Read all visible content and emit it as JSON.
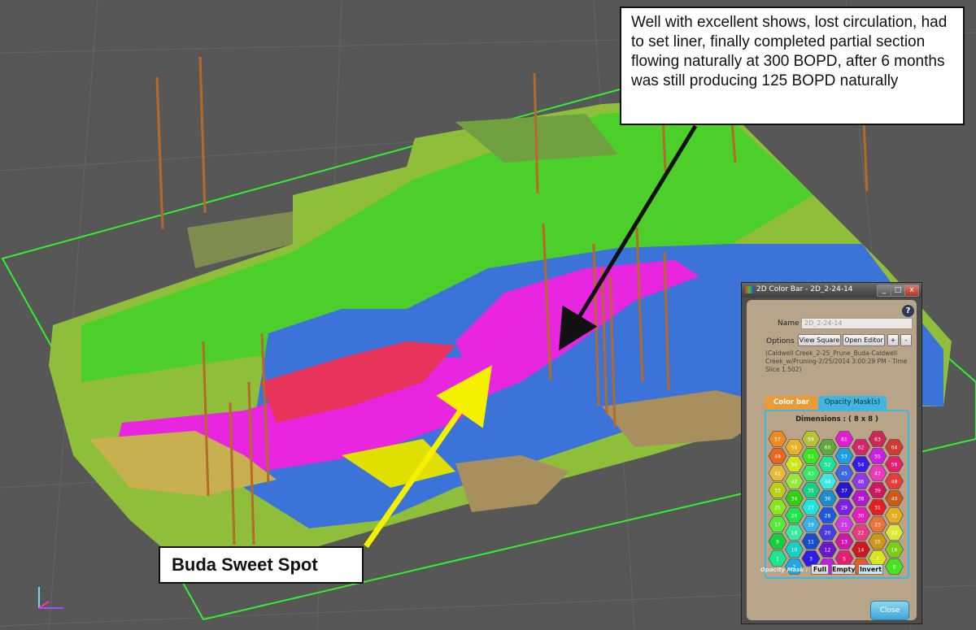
{
  "callouts": {
    "well_note": "Well with excellent shows, lost circulation, had to set liner, finally completed partial section flowing naturally at 300 BOPD, after 6 months was still producing 125 BOPD naturally",
    "sweet_spot": "Buda Sweet Spot"
  },
  "dialog": {
    "title": "2D Color Bar - 2D_2-24-14",
    "name_label": "Name :",
    "name_value": "2D_2-24-14",
    "options_label": "Options :",
    "view_square": "View Square",
    "open_editor": "Open Editor",
    "plus": "+",
    "minus": "-",
    "help": "?",
    "description": "(Caldwell Creek_2-25_Prune_Buda-Caldwell Creek_w/Pruning-2/25/2014 3:00:29 PM - Time Slice 1.502)",
    "tab_color_bar": "Color bar",
    "tab_opacity": "Opacity Mask(s)",
    "dimensions": "Dimensions :  ( 8 x 8 )",
    "opacity_mask_label": "Opacity Mask :",
    "full": "Full",
    "empty": "Empty",
    "invert": "Invert",
    "close": "Close",
    "window_buttons": [
      "_",
      "□",
      "x"
    ],
    "hex_grid": [
      [
        57,
        58,
        59,
        60,
        61,
        62,
        63,
        64
      ],
      [
        49,
        50,
        51,
        52,
        53,
        54,
        55,
        56
      ],
      [
        41,
        42,
        43,
        44,
        45,
        46,
        47,
        48
      ],
      [
        33,
        34,
        35,
        36,
        37,
        38,
        39,
        40
      ],
      [
        25,
        26,
        27,
        28,
        29,
        30,
        31,
        32
      ],
      [
        17,
        18,
        19,
        20,
        21,
        22,
        23,
        24
      ],
      [
        9,
        10,
        11,
        12,
        13,
        14,
        15,
        16
      ],
      [
        1,
        2,
        3,
        4,
        5,
        6,
        7,
        8
      ]
    ]
  },
  "colors": {
    "background": "#575757",
    "surface_green": "#4ccf2a",
    "surface_magenta": "#e826e0",
    "surface_blue": "#3b73d8",
    "surface_tan": "#a88f5e",
    "arrow_yellow": "#f4f000",
    "arrow_black": "#111111",
    "outline_green": "#33ee33"
  }
}
